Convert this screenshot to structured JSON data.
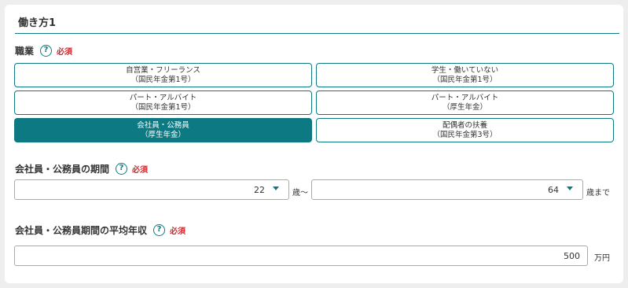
{
  "section": {
    "title": "働き方1"
  },
  "occupation": {
    "label": "職業",
    "help": "?",
    "required": "必須",
    "options": [
      {
        "line1": "自営業・フリーランス",
        "line2": "（国民年金第1号）",
        "selected": false
      },
      {
        "line1": "学生・働いていない",
        "line2": "（国民年金第1号）",
        "selected": false
      },
      {
        "line1": "パート・アルバイト",
        "line2": "（国民年金第1号）",
        "selected": false
      },
      {
        "line1": "パート・アルバイト",
        "line2": "（厚生年金）",
        "selected": false
      },
      {
        "line1": "会社員・公務員",
        "line2": "（厚生年金）",
        "selected": true
      },
      {
        "line1": "配偶者の扶養",
        "line2": "（国民年金第3号）",
        "selected": false
      }
    ]
  },
  "period": {
    "label": "会社員・公務員の期間",
    "help": "?",
    "required": "必須",
    "from_value": "22",
    "from_unit": "歳〜",
    "to_value": "64",
    "to_unit": "歳まで"
  },
  "income": {
    "label": "会社員・公務員期間の平均年収",
    "help": "?",
    "required": "必須",
    "value": "500",
    "unit": "万円"
  },
  "colors": {
    "accent": "#0d7a83",
    "required": "#d6262b"
  }
}
